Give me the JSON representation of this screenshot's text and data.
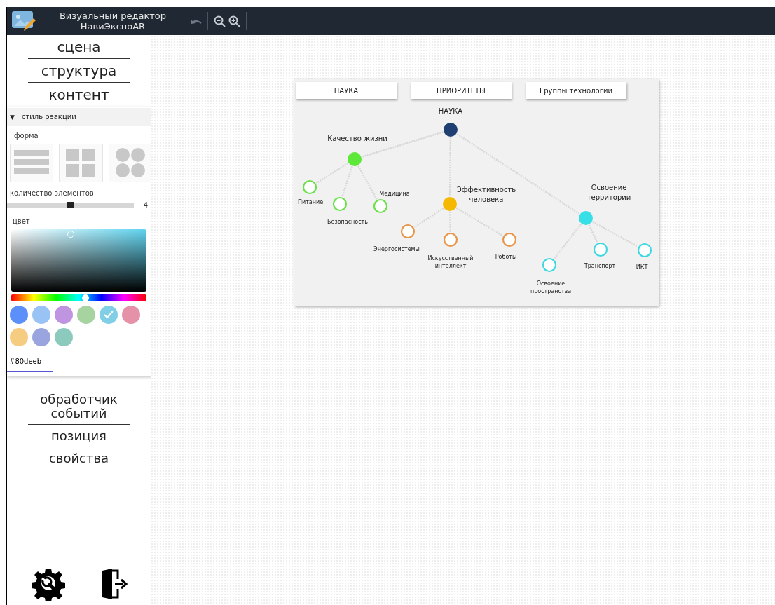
{
  "header": {
    "title_lines": [
      "Визуальный редактор",
      "НавиЭкспоAR"
    ],
    "toolbar": [
      {
        "kind": "undo",
        "disabled": true
      },
      {
        "kind": "zoom-out",
        "disabled": false
      },
      {
        "kind": "zoom-in",
        "disabled": false
      }
    ]
  },
  "sidebar": {
    "sections_top": [
      "сцена",
      "структура",
      "контент"
    ],
    "panel": {
      "toggle": "▼",
      "title": "стиль реакции",
      "expanded": true,
      "shape_label": "форма",
      "shapes": [
        {
          "kind": "rows",
          "selected": false
        },
        {
          "kind": "grid",
          "selected": false
        },
        {
          "kind": "circles",
          "selected": true
        }
      ],
      "count": {
        "label": "количество элементов",
        "level": 0.5,
        "value": "4"
      },
      "color_label": "цвет",
      "hue": {
        "level": 0.55
      },
      "swatches": [
        {
          "color": "#5b8ff9",
          "selected": false
        },
        {
          "color": "#99c2f5",
          "selected": false
        },
        {
          "color": "#bf94e0",
          "selected": false
        },
        {
          "color": "#a7d3a0",
          "selected": false
        },
        {
          "color": "#80cfe6",
          "selected": true
        },
        {
          "color": "#e591a8",
          "selected": false
        },
        {
          "color": "#f5cc80",
          "selected": false
        },
        {
          "color": "#9aa4df",
          "selected": false
        },
        {
          "color": "#8ccabe",
          "selected": false
        }
      ],
      "hex_value": "#80deeb"
    },
    "sections_bottom": [
      "обработчик событий",
      "позиция",
      "свойства"
    ]
  },
  "canvas": {
    "tabs": [
      {
        "label": "НАУКА",
        "selected": false
      },
      {
        "label": "ПРИОРИТЕТЫ",
        "selected": false
      },
      {
        "label": "Группы технологий",
        "selected": false
      }
    ],
    "diagram": {
      "label": "НАУКА",
      "color": "#1f3f73",
      "children": [
        {
          "label": "Качество жизни",
          "color": "#5ee83a",
          "children": [
            {
              "label": "Питание",
              "color": "#6be04a"
            },
            {
              "label": "Безопасность",
              "color": "#6be04a"
            },
            {
              "label": "Медицина",
              "color": "#6be04a"
            }
          ]
        },
        {
          "label": "Эффективность человека",
          "color": "#f5b800",
          "children": [
            {
              "label": "Энергосистемы",
              "color": "#e8954a"
            },
            {
              "label": "Искусственный интеллект",
              "color": "#e8954a"
            },
            {
              "label": "Роботы",
              "color": "#e8954a"
            }
          ]
        },
        {
          "label": "Освоение территории",
          "color": "#38dfe6",
          "children": [
            {
              "label": "Освоение пространства",
              "color": "#40d8e0"
            },
            {
              "label": "Транспорт",
              "color": "#40d8e0"
            },
            {
              "label": "ИКТ",
              "color": "#40d8e0"
            }
          ]
        }
      ]
    }
  }
}
